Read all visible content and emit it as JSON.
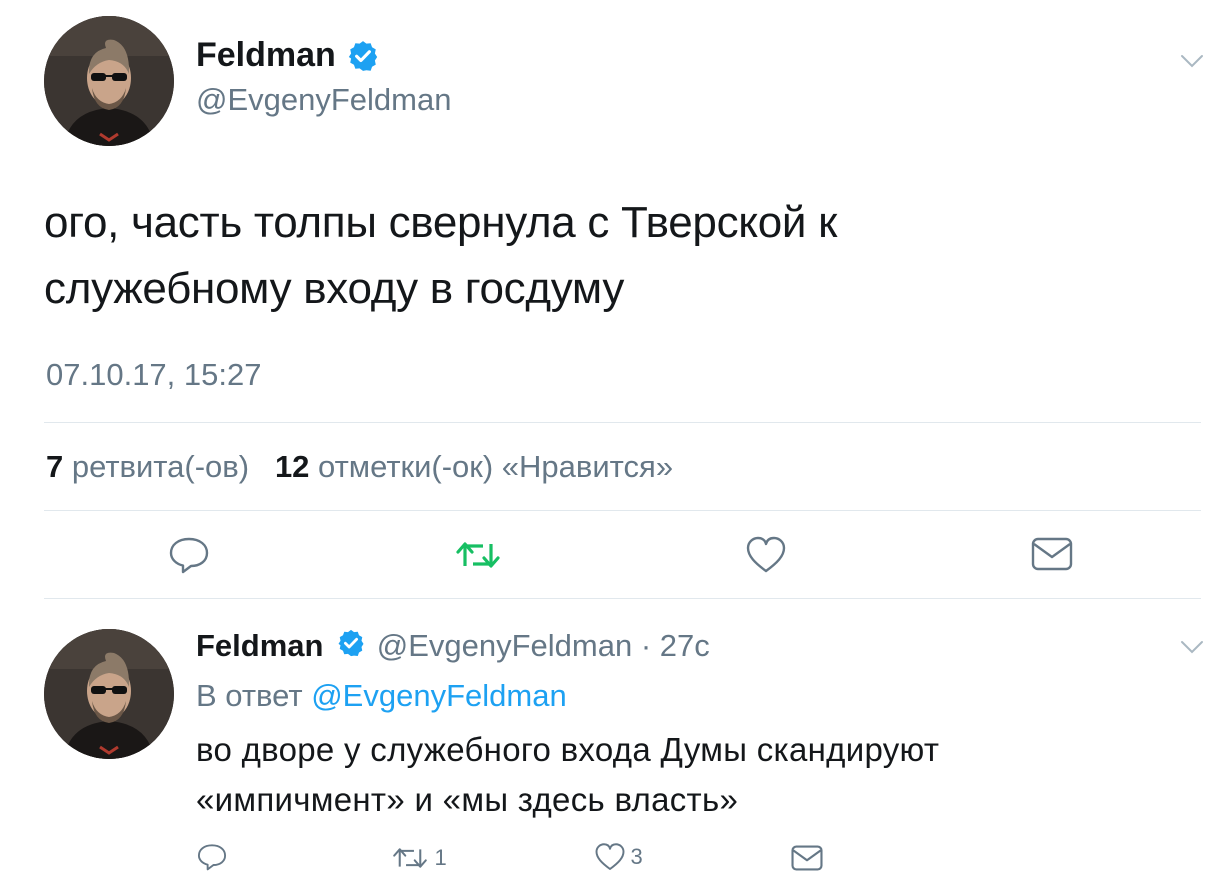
{
  "main_tweet": {
    "author_name": "Feldman",
    "author_handle": "@EvgenyFeldman",
    "text_line1": "ого, часть толпы свернула с Тверской к",
    "text_line2": "служебному входу в госдуму",
    "timestamp": "07.10.17, 15:27",
    "retweets_count": "7",
    "retweets_label": "ретвита(-ов)",
    "likes_count": "12",
    "likes_label": "отметки(-ок) «Нравится»"
  },
  "reply_tweet": {
    "author_name": "Feldman",
    "author_handle": "@EvgenyFeldman",
    "separator": "·",
    "age": "27с",
    "in_reply_prefix": "В ответ",
    "in_reply_handle": "@EvgenyFeldman",
    "text_line1": "во дворе у служебного входа Думы скандируют",
    "text_line2": "«импичмент» и «мы здесь власть»",
    "retweet_count": "1",
    "like_count": "3"
  },
  "icons": {
    "verified": "verified-badge-icon",
    "menu": "chevron-down-icon",
    "reply": "reply-icon",
    "retweet": "retweet-icon",
    "like": "heart-icon",
    "dm": "envelope-icon"
  },
  "colors": {
    "accent": "#1da1f2",
    "retweet_active": "#17bf63",
    "muted": "#657786",
    "text": "#14171a",
    "divider": "#e1e8ed"
  }
}
